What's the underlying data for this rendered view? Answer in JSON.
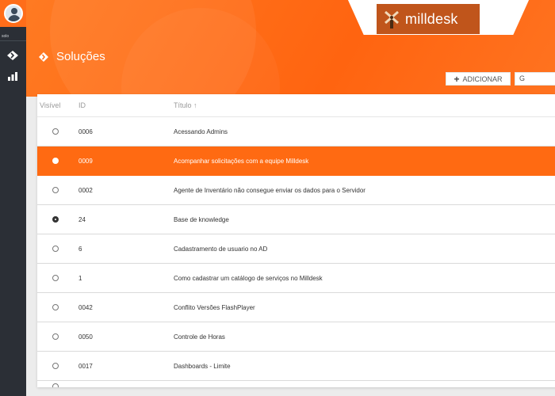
{
  "sidebar": {
    "user_label": "solo",
    "items": [
      {
        "name": "solutions",
        "icon": "diamond-arrow-icon"
      },
      {
        "name": "reports",
        "icon": "bar-chart-icon"
      }
    ]
  },
  "header": {
    "logo_text": "milldesk",
    "page_title": "Soluções",
    "add_label": "ADICIONAR",
    "second_label": "G"
  },
  "table": {
    "columns": {
      "visible": "Visível",
      "id": "ID",
      "title": "Título ↑"
    },
    "rows": [
      {
        "id": "0006",
        "title": "Acessando Admins",
        "visible_state": "off"
      },
      {
        "id": "0009",
        "title": "Acompanhar solicitações com a equipe Milldesk",
        "visible_state": "off",
        "selected": true
      },
      {
        "id": "0002",
        "title": "Agente de Inventário não consegue enviar os dados para o Servidor",
        "visible_state": "off"
      },
      {
        "id": "24",
        "title": "Base de knowledge",
        "visible_state": "eye"
      },
      {
        "id": "6",
        "title": "Cadastramento de usuario no AD",
        "visible_state": "off"
      },
      {
        "id": "1",
        "title": "Como cadastrar um catálogo de serviços no Milldesk",
        "visible_state": "off"
      },
      {
        "id": "0042",
        "title": "Conflito Versões FlashPlayer",
        "visible_state": "off"
      },
      {
        "id": "0050",
        "title": "Controle de Horas",
        "visible_state": "off"
      },
      {
        "id": "0017",
        "title": "Dashboards - Limite",
        "visible_state": "off"
      }
    ]
  },
  "colors": {
    "accent": "#ff6a12",
    "sidebar": "#2b2f36",
    "logo_bg": "#c0551b"
  }
}
